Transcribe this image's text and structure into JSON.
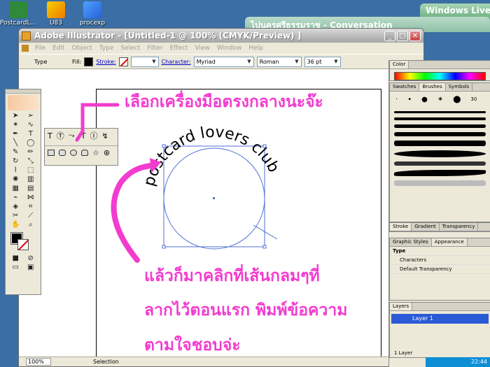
{
  "desktop": {
    "icons": [
      {
        "label": "PostcardL..."
      },
      {
        "label": "U83"
      },
      {
        "label": "procexp"
      }
    ],
    "bg_windows": {
      "conversation_title": "ไปนครศรีธรรมราช - Conversation",
      "live_title": "Windows Live"
    }
  },
  "window": {
    "title": "Adobe Illustrator - [Untitled-1 @ 100% (CMYK/Preview) ]",
    "buttons": {
      "minimize": "_",
      "maximize": "□",
      "close": "✕"
    }
  },
  "menu": [
    "File",
    "Edit",
    "Object",
    "Type",
    "Select",
    "Filter",
    "Effect",
    "View",
    "Window",
    "Help"
  ],
  "control_bar": {
    "type_label": "Type",
    "fill_label": "Fill:",
    "stroke_label": "Stroke:",
    "character_label": "Character:",
    "font": "Myriad",
    "style": "Roman",
    "size": "36 pt"
  },
  "canvas": {
    "path_text": "postcard lovers club"
  },
  "status_bar": {
    "zoom": "100%",
    "mode": "Selection"
  },
  "palettes": {
    "color_tab": "Color",
    "brush_tabs": [
      "Swatches",
      "Brushes",
      "Symbols"
    ],
    "brush_size_label": "30",
    "stroke_tabs": [
      "Stroke",
      "Gradient",
      "Transparency"
    ],
    "appearance_tabs": [
      "Graphic Styles",
      "Appearance"
    ],
    "appearance_rows": [
      "Type",
      "Characters",
      "Default Transparency"
    ],
    "layers_tab": "Layers",
    "layer_name": "Layer 1",
    "layers_count": "1 Layer"
  },
  "tray": {
    "time": "22:44"
  },
  "annotations": {
    "step1": "เลือกเครื่องมือตรงกลางนะจ๊ะ",
    "step2": "แล้วก็มาคลิกที่เส้นกลมๆที่",
    "step3": "ลากไว้ตอนแรก พิมพ์ข้อความ",
    "step4": "ตามใจชอบจ่ะ",
    "color": "#f23ccf"
  }
}
